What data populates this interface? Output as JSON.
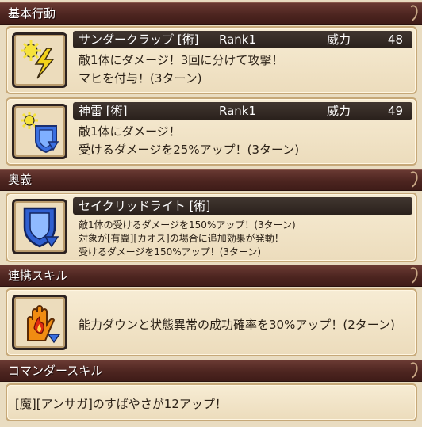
{
  "sections": {
    "basic": {
      "title": "基本行動"
    },
    "ougi": {
      "title": "奥義"
    },
    "link": {
      "title": "連携スキル"
    },
    "commander": {
      "title": "コマンダースキル"
    }
  },
  "skills": [
    {
      "name": "サンダークラップ [術]",
      "rank": "Rank1",
      "power_label": "威力",
      "power": "48",
      "desc": [
        "敵1体にダメージ！3回に分けて攻撃！",
        "マヒを付与！(3ターン)"
      ],
      "icon": "thunder-bolt-icon"
    },
    {
      "name": "神雷 [術]",
      "rank": "Rank1",
      "power_label": "威力",
      "power": "49",
      "desc": [
        "敵1体にダメージ！",
        "受けるダメージを25%アップ！(3ターン)"
      ],
      "icon": "thunder-shield-icon"
    }
  ],
  "ougi_skill": {
    "name": "セイクリッドライト [術]",
    "desc": [
      "敵1体の受けるダメージを150%アップ！(3ターン)",
      "対象が[有翼][カオス]の場合に追加効果が発動！",
      "受けるダメージを150%アップ！(3ターン)"
    ],
    "icon": "shield-down-icon"
  },
  "link_skill": {
    "desc": "能力ダウンと状態異常の成功確率を30%アップ！(2ターン)",
    "icon": "hand-flame-icon"
  },
  "commander_skill": {
    "desc": "[魔][アンサガ]のすばやさが12アップ！"
  },
  "colors": {
    "header_bg": "#4d2520",
    "card_bg": "#f1e3c6",
    "name_bar_bg": "#2f2520",
    "shield_blue": "#3a6fe0",
    "bolt_yellow": "#f3d21a",
    "flame_orange": "#f08c12"
  }
}
